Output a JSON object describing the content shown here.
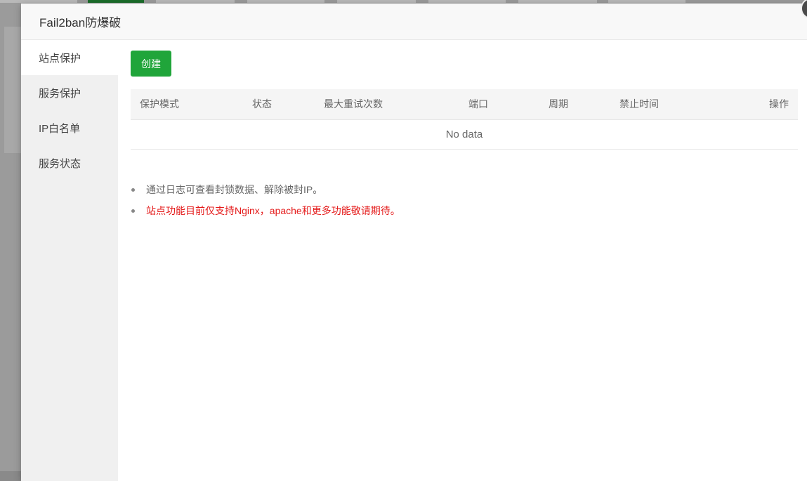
{
  "dialog": {
    "title": "Fail2ban防爆破",
    "close_icon": "close-icon"
  },
  "sidebar": {
    "items": [
      {
        "label": "站点保护",
        "active": true
      },
      {
        "label": "服务保护",
        "active": false
      },
      {
        "label": "IP白名单",
        "active": false
      },
      {
        "label": "服务状态",
        "active": false
      }
    ]
  },
  "toolbar": {
    "create_label": "创建",
    "create_color": "#20a53a"
  },
  "table": {
    "columns": [
      "保护模式",
      "状态",
      "最大重试次数",
      "端口",
      "周期",
      "禁止时间",
      "操作"
    ],
    "empty_text": "No data"
  },
  "tips": [
    {
      "text": "通过日志可查看封锁数据、解除被封IP。",
      "color": "#666666"
    },
    {
      "text": "站点功能目前仅支持Nginx，apache和更多功能敬请期待。",
      "color": "#e41a1a"
    }
  ]
}
